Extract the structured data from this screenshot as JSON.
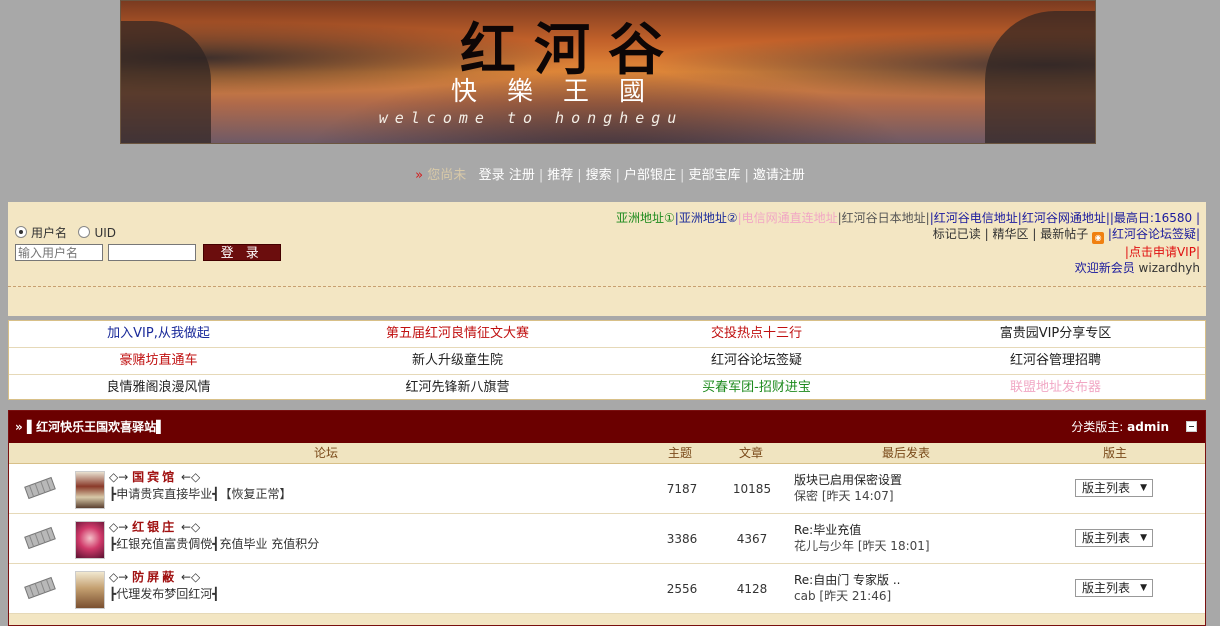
{
  "banner": {
    "title": "红河谷",
    "subtitle": "快樂王國",
    "welcome": "welcome to honghegu"
  },
  "topnav": {
    "arrow": "»",
    "status": "您尚未",
    "items": [
      "登录",
      "注册",
      "推荐",
      "搜索",
      "户部银庄",
      "吏部宝库",
      "邀请注册"
    ]
  },
  "login": {
    "radio_username": "用户名",
    "radio_uid": "UID",
    "username_placeholder": "输入用户名",
    "password_value": "",
    "submit": "登 录"
  },
  "rightlinks": {
    "line1": [
      {
        "text": "亚洲地址①",
        "color": "#1e8b1e"
      },
      {
        "text": "|亚洲地址②",
        "color": "#1a2a9a"
      },
      {
        "text": "|电信网通直连地址",
        "color": "#f1a7c4"
      },
      {
        "text": "|红河谷日本地址|",
        "color": "#555555"
      },
      {
        "text": "|红河谷电信地址|",
        "color": "#1a1a9e"
      },
      {
        "text": "红河谷网通地址|",
        "color": "#1a1a9e"
      },
      {
        "text": "|最高日:16580 |",
        "color": "#1a1a9e"
      }
    ],
    "line2": {
      "mark_read": "标记已读",
      "elite": "精华区",
      "latest": "最新帖子",
      "rss": "rss",
      "checkin": "|红河谷论坛签疑|"
    },
    "line3": "|点击申请VIP|",
    "welcome_label": "欢迎新会员",
    "welcome_user": "wizardhyh"
  },
  "linkgrid": [
    [
      {
        "text": "加入VIP,从我做起",
        "color": "#1a2a9a"
      },
      {
        "text": "第五届红河良情征文大赛",
        "color": "#c01010"
      },
      {
        "text": "交投热点十三行",
        "color": "#c01010"
      },
      {
        "text": "富贵园VIP分享专区",
        "color": "#222222"
      }
    ],
    [
      {
        "text": "豪赌坊直通车",
        "color": "#c01010"
      },
      {
        "text": "新人升级童生院",
        "color": "#222222"
      },
      {
        "text": "红河谷论坛签疑",
        "color": "#222222"
      },
      {
        "text": "红河谷管理招聘",
        "color": "#222222"
      }
    ],
    [
      {
        "text": "良情雅阁浪漫风情",
        "color": "#222222"
      },
      {
        "text": "红河先锋新八旗营",
        "color": "#222222"
      },
      {
        "text": "买春军团-招财进宝",
        "color": "#1e8b1e"
      },
      {
        "text": "联盟地址发布器",
        "color": "#f1a7c4"
      }
    ]
  ],
  "forum": {
    "arrow": "»",
    "title": "▌红河快乐王国欢喜驿站▌",
    "moderator_label": "分类版主:",
    "moderator_name": "admin",
    "columns": {
      "forum": "论坛",
      "topics": "主题",
      "posts": "文章",
      "last": "最后发表",
      "mods": "版主"
    },
    "rows": [
      {
        "prefix": "◇→",
        "name": "国宾馆",
        "suffix": "←◇",
        "desc": "┣申请贵宾直接毕业┫【恢复正常】",
        "topics": "7187",
        "posts": "10185",
        "last_title": "版块已启用保密设置",
        "last_by": "保密 [昨天 14:07]",
        "mod_select": "版主列表",
        "thumb_color": "#8a3a2a"
      },
      {
        "prefix": "◇→",
        "name": "红银庄",
        "suffix": "←◇",
        "desc": "┣红银充值富贵倜傥┫充值毕业 充值积分",
        "topics": "3386",
        "posts": "4367",
        "last_title": "Re:毕业充值",
        "last_by": "花儿与少年 [昨天 18:01]",
        "mod_select": "版主列表",
        "thumb_color": "#d03a6a"
      },
      {
        "prefix": "◇→",
        "name": "防屏蔽",
        "suffix": "←◇",
        "desc": "┣代理发布梦回红河┫",
        "topics": "2556",
        "posts": "4128",
        "last_title": "Re:自由门 专家版 ..",
        "last_by": "cab [昨天 21:46]",
        "mod_select": "版主列表",
        "thumb_color": "#b08850"
      }
    ]
  }
}
